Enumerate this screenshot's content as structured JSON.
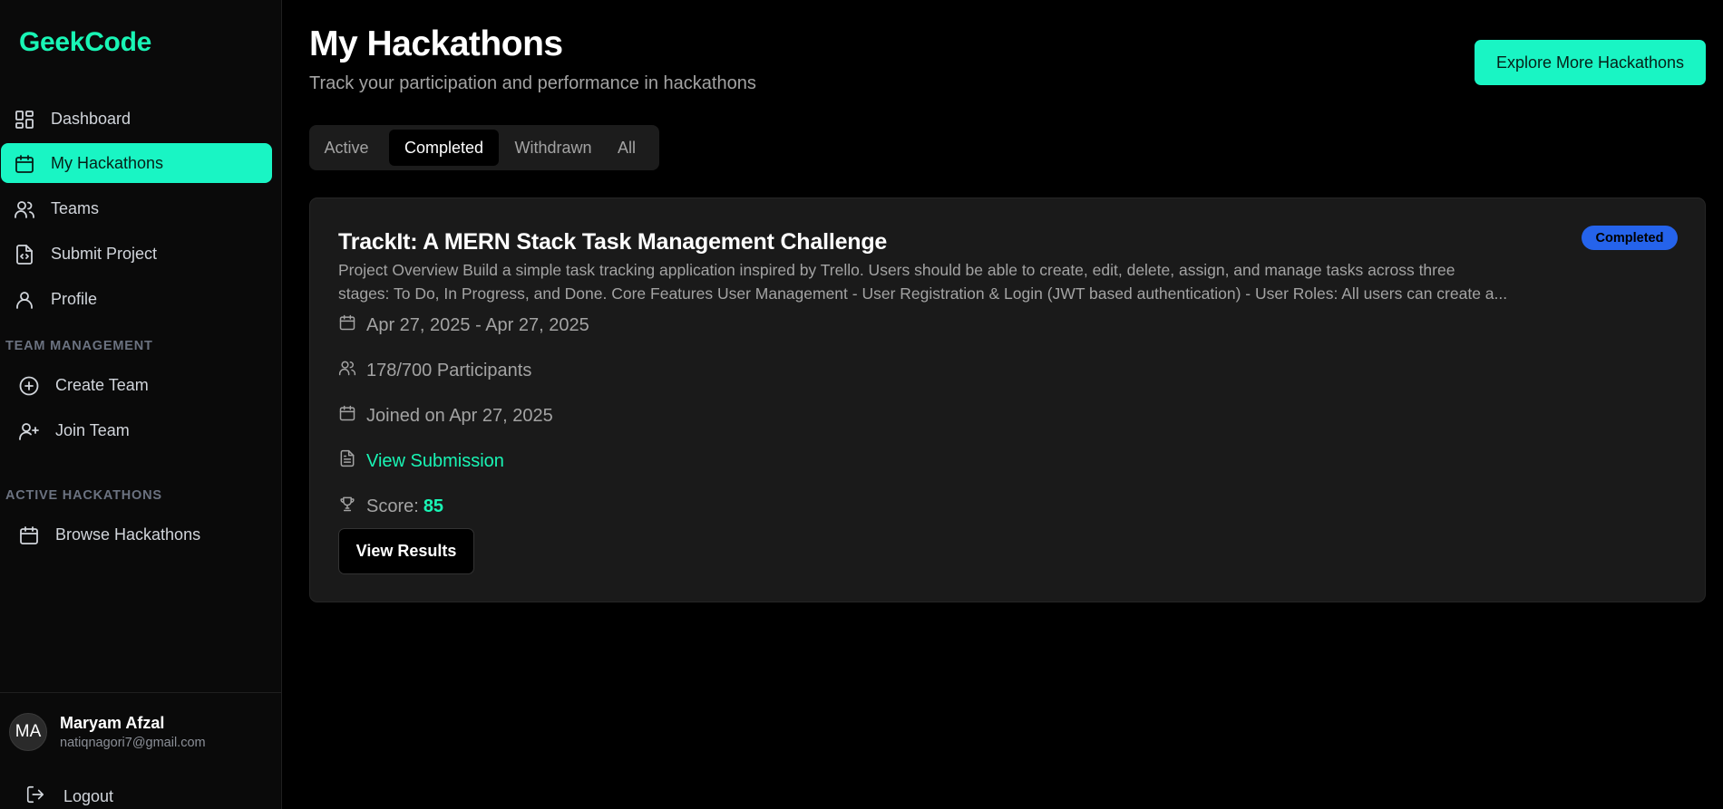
{
  "brand": "GeekCode",
  "colors": {
    "accent": "#19f5c4",
    "badge": "#2563eb",
    "background": "#000000",
    "card": "#1a1a1a"
  },
  "sidebar": {
    "items": [
      {
        "label": "Dashboard",
        "icon": "dashboard-grid-icon"
      },
      {
        "label": "My Hackathons",
        "icon": "calendar-icon",
        "active": true
      },
      {
        "label": "Teams",
        "icon": "users-icon"
      },
      {
        "label": "Submit Project",
        "icon": "file-code-icon"
      },
      {
        "label": "Profile",
        "icon": "user-icon"
      }
    ],
    "team_section_label": "TEAM MANAGEMENT",
    "team_items": [
      {
        "label": "Create Team",
        "icon": "plus-circle-icon"
      },
      {
        "label": "Join Team",
        "icon": "user-plus-icon"
      }
    ],
    "active_section_label": "ACTIVE HACKATHONS",
    "active_items": [
      {
        "label": "Browse Hackathons",
        "icon": "calendar-icon"
      }
    ]
  },
  "user": {
    "initials": "MA",
    "name": "Maryam Afzal",
    "email": "natiqnagori7@gmail.com",
    "logout_label": "Logout"
  },
  "header": {
    "title": "My Hackathons",
    "subtitle": "Track your participation and performance in hackathons",
    "explore_button": "Explore More Hackathons"
  },
  "tabs": [
    {
      "label": "Active"
    },
    {
      "label": "Completed",
      "active": true
    },
    {
      "label": "Withdrawn"
    },
    {
      "label": "All"
    }
  ],
  "hackathon": {
    "title": "TrackIt: A MERN Stack Task Management Challenge",
    "status": "Completed",
    "description_line1": "Project Overview Build a simple task tracking application inspired by Trello. Users should be able to create, edit, delete, assign, and manage tasks across three",
    "description_line2": "stages: To Do, In Progress, and Done. Core Features User Management - User Registration & Login (JWT based authentication) - User Roles: All users can create a...",
    "dates": "Apr 27, 2025 - Apr 27, 2025",
    "participants": "178/700 Participants",
    "joined": "Joined on Apr 27, 2025",
    "submission_link": "View Submission",
    "score_label": "Score:",
    "score_value": "85",
    "results_button": "View Results"
  }
}
